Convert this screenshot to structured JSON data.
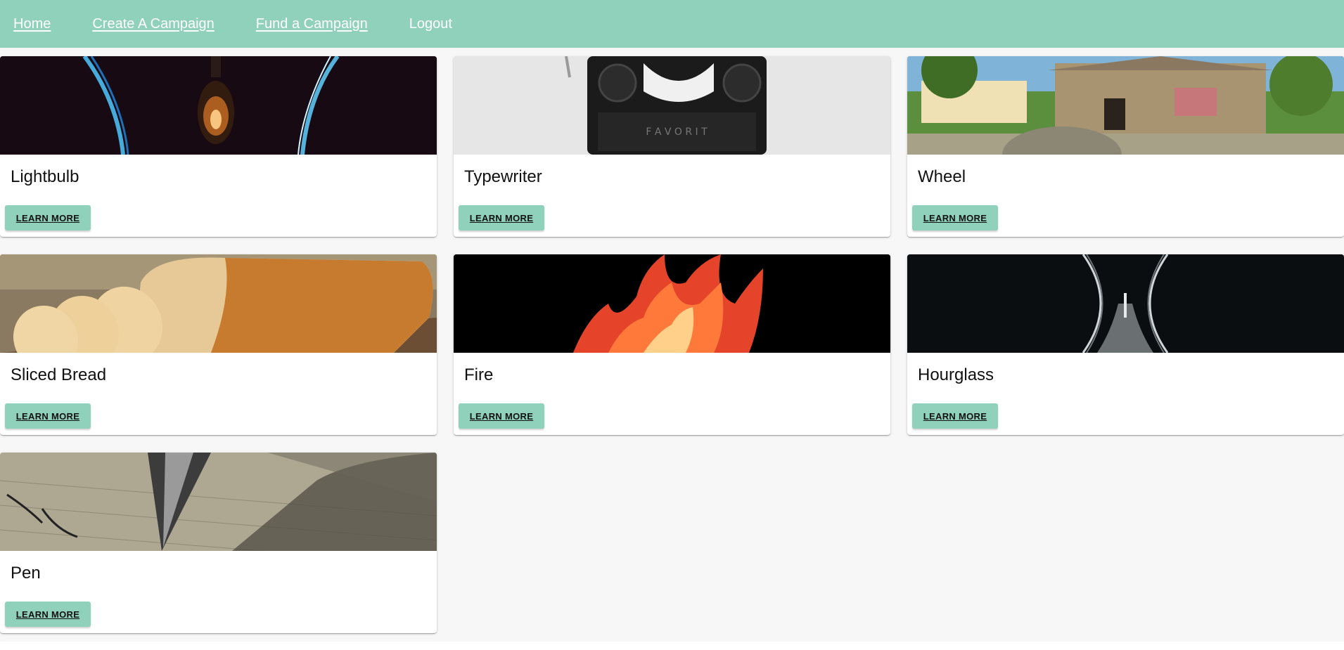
{
  "nav": {
    "items": [
      {
        "label": "Home"
      },
      {
        "label": "Create A Campaign"
      },
      {
        "label": "Fund a Campaign"
      },
      {
        "label": "Logout"
      }
    ]
  },
  "cards": [
    {
      "title": "Lightbulb",
      "button": "LEARN MORE"
    },
    {
      "title": "Typewriter",
      "button": "LEARN MORE"
    },
    {
      "title": "Wheel",
      "button": "LEARN MORE"
    },
    {
      "title": "Sliced Bread",
      "button": "LEARN MORE"
    },
    {
      "title": "Fire",
      "button": "LEARN MORE"
    },
    {
      "title": "Hourglass",
      "button": "LEARN MORE"
    },
    {
      "title": "Pen",
      "button": "LEARN MORE"
    }
  ],
  "colors": {
    "accent": "#90d1bb",
    "page_background": "#f7f7f7",
    "card_background": "#ffffff",
    "title_text": "#111111"
  }
}
